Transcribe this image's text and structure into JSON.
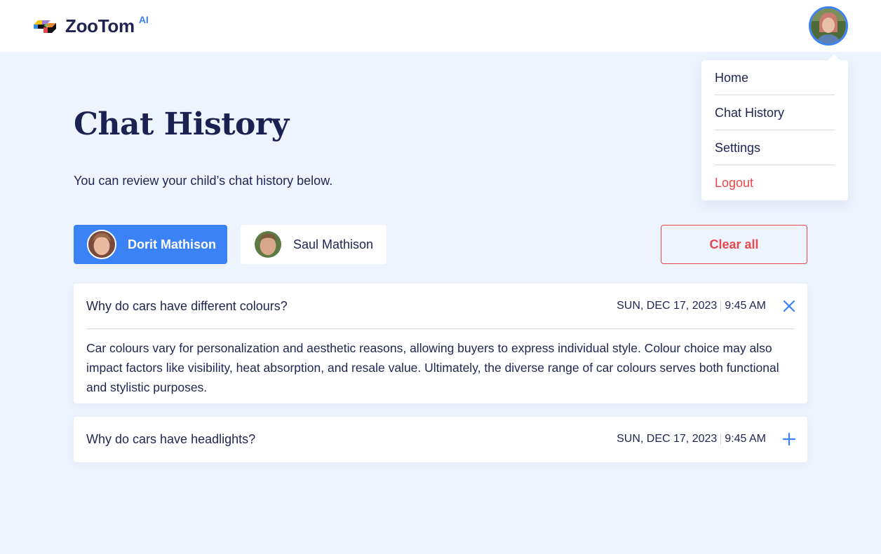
{
  "header": {
    "brand": "ZooTom",
    "brand_badge": "AI",
    "avatar_icon": "user-avatar"
  },
  "menu": {
    "items": [
      {
        "label": "Home"
      },
      {
        "label": "Chat History"
      },
      {
        "label": "Settings"
      },
      {
        "label": "Logout"
      }
    ]
  },
  "page": {
    "title": "Chat History",
    "subtitle": "You can review your child’s chat history below."
  },
  "children": [
    {
      "name": "Dorit Mathison",
      "active": true
    },
    {
      "name": "Saul Mathison",
      "active": false
    }
  ],
  "actions": {
    "clear_all": "Clear all"
  },
  "chats": [
    {
      "question": "Why do cars have different colours?",
      "date": "SUN, DEC 17, 2023",
      "time": "9:45 AM",
      "expanded": true,
      "toggle_icon": "close-icon",
      "answer": "Car colours vary for personalization and aesthetic reasons, allowing buyers to express individual style. Colour choice may also impact factors like visibility, heat absorption, and resale value. Ultimately, the diverse range of car colours serves both functional and stylistic purposes."
    },
    {
      "question": "Why do cars have headlights?",
      "date": "SUN, DEC 17, 2023",
      "time": "9:45 AM",
      "expanded": false,
      "toggle_icon": "plus-icon"
    }
  ],
  "colors": {
    "accent": "#3b82f6",
    "danger": "#e5484d",
    "text": "#1f2452",
    "background": "#eef4fd"
  }
}
